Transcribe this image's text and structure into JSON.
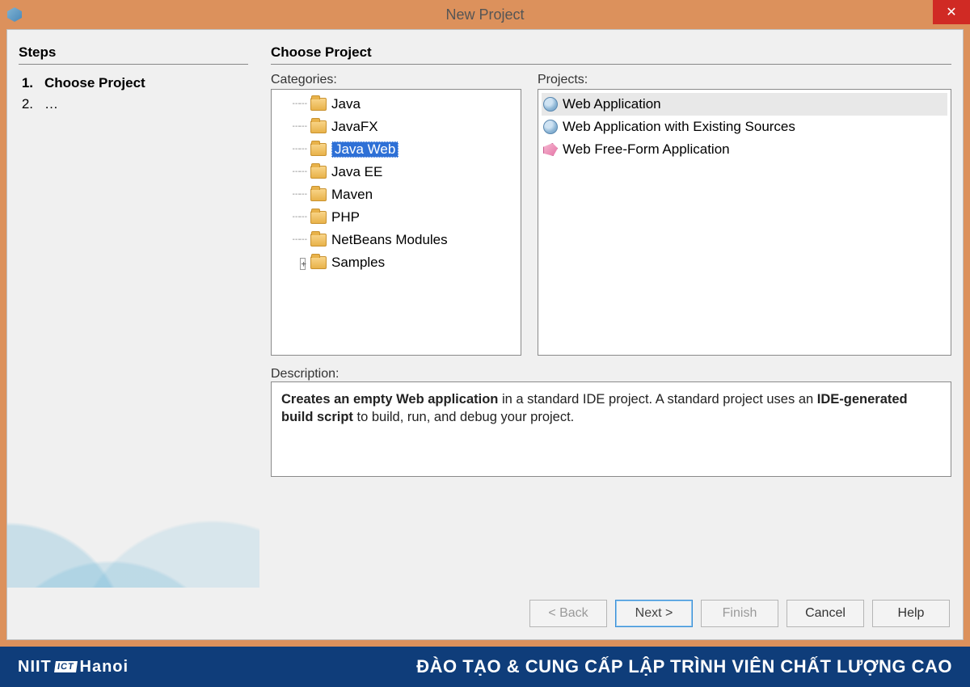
{
  "window": {
    "title": "New Project"
  },
  "sidebar": {
    "heading": "Steps",
    "steps": [
      {
        "num": "1.",
        "label": "Choose Project",
        "current": true
      },
      {
        "num": "2.",
        "label": "…",
        "current": false
      }
    ]
  },
  "main": {
    "heading": "Choose Project",
    "categories_label": "Categories:",
    "projects_label": "Projects:",
    "categories": [
      {
        "label": "Java",
        "expandable": false,
        "selected": false
      },
      {
        "label": "JavaFX",
        "expandable": false,
        "selected": false
      },
      {
        "label": "Java Web",
        "expandable": false,
        "selected": true
      },
      {
        "label": "Java EE",
        "expandable": false,
        "selected": false
      },
      {
        "label": "Maven",
        "expandable": false,
        "selected": false
      },
      {
        "label": "PHP",
        "expandable": false,
        "selected": false
      },
      {
        "label": "NetBeans Modules",
        "expandable": false,
        "selected": false
      },
      {
        "label": "Samples",
        "expandable": true,
        "selected": false
      }
    ],
    "projects": [
      {
        "label": "Web Application",
        "icon": "globe",
        "selected": true
      },
      {
        "label": "Web Application with Existing Sources",
        "icon": "globe",
        "selected": false
      },
      {
        "label": "Web Free-Form Application",
        "icon": "pink",
        "selected": false
      }
    ],
    "description_label": "Description:",
    "description": {
      "bold1": "Creates an empty Web application",
      "mid1": " in a standard IDE project. A standard project uses an ",
      "bold2": "IDE-generated build script",
      "mid2": " to build, run, and debug your project."
    }
  },
  "buttons": {
    "back": "< Back",
    "next": "Next >",
    "finish": "Finish",
    "cancel": "Cancel",
    "help": "Help"
  },
  "banner": {
    "brand_left": "NIIT",
    "brand_box": "ICT",
    "brand_right": "Hanoi",
    "text": "ĐÀO TẠO & CUNG CẤP LẬP TRÌNH VIÊN CHẤT LƯỢNG CAO"
  }
}
